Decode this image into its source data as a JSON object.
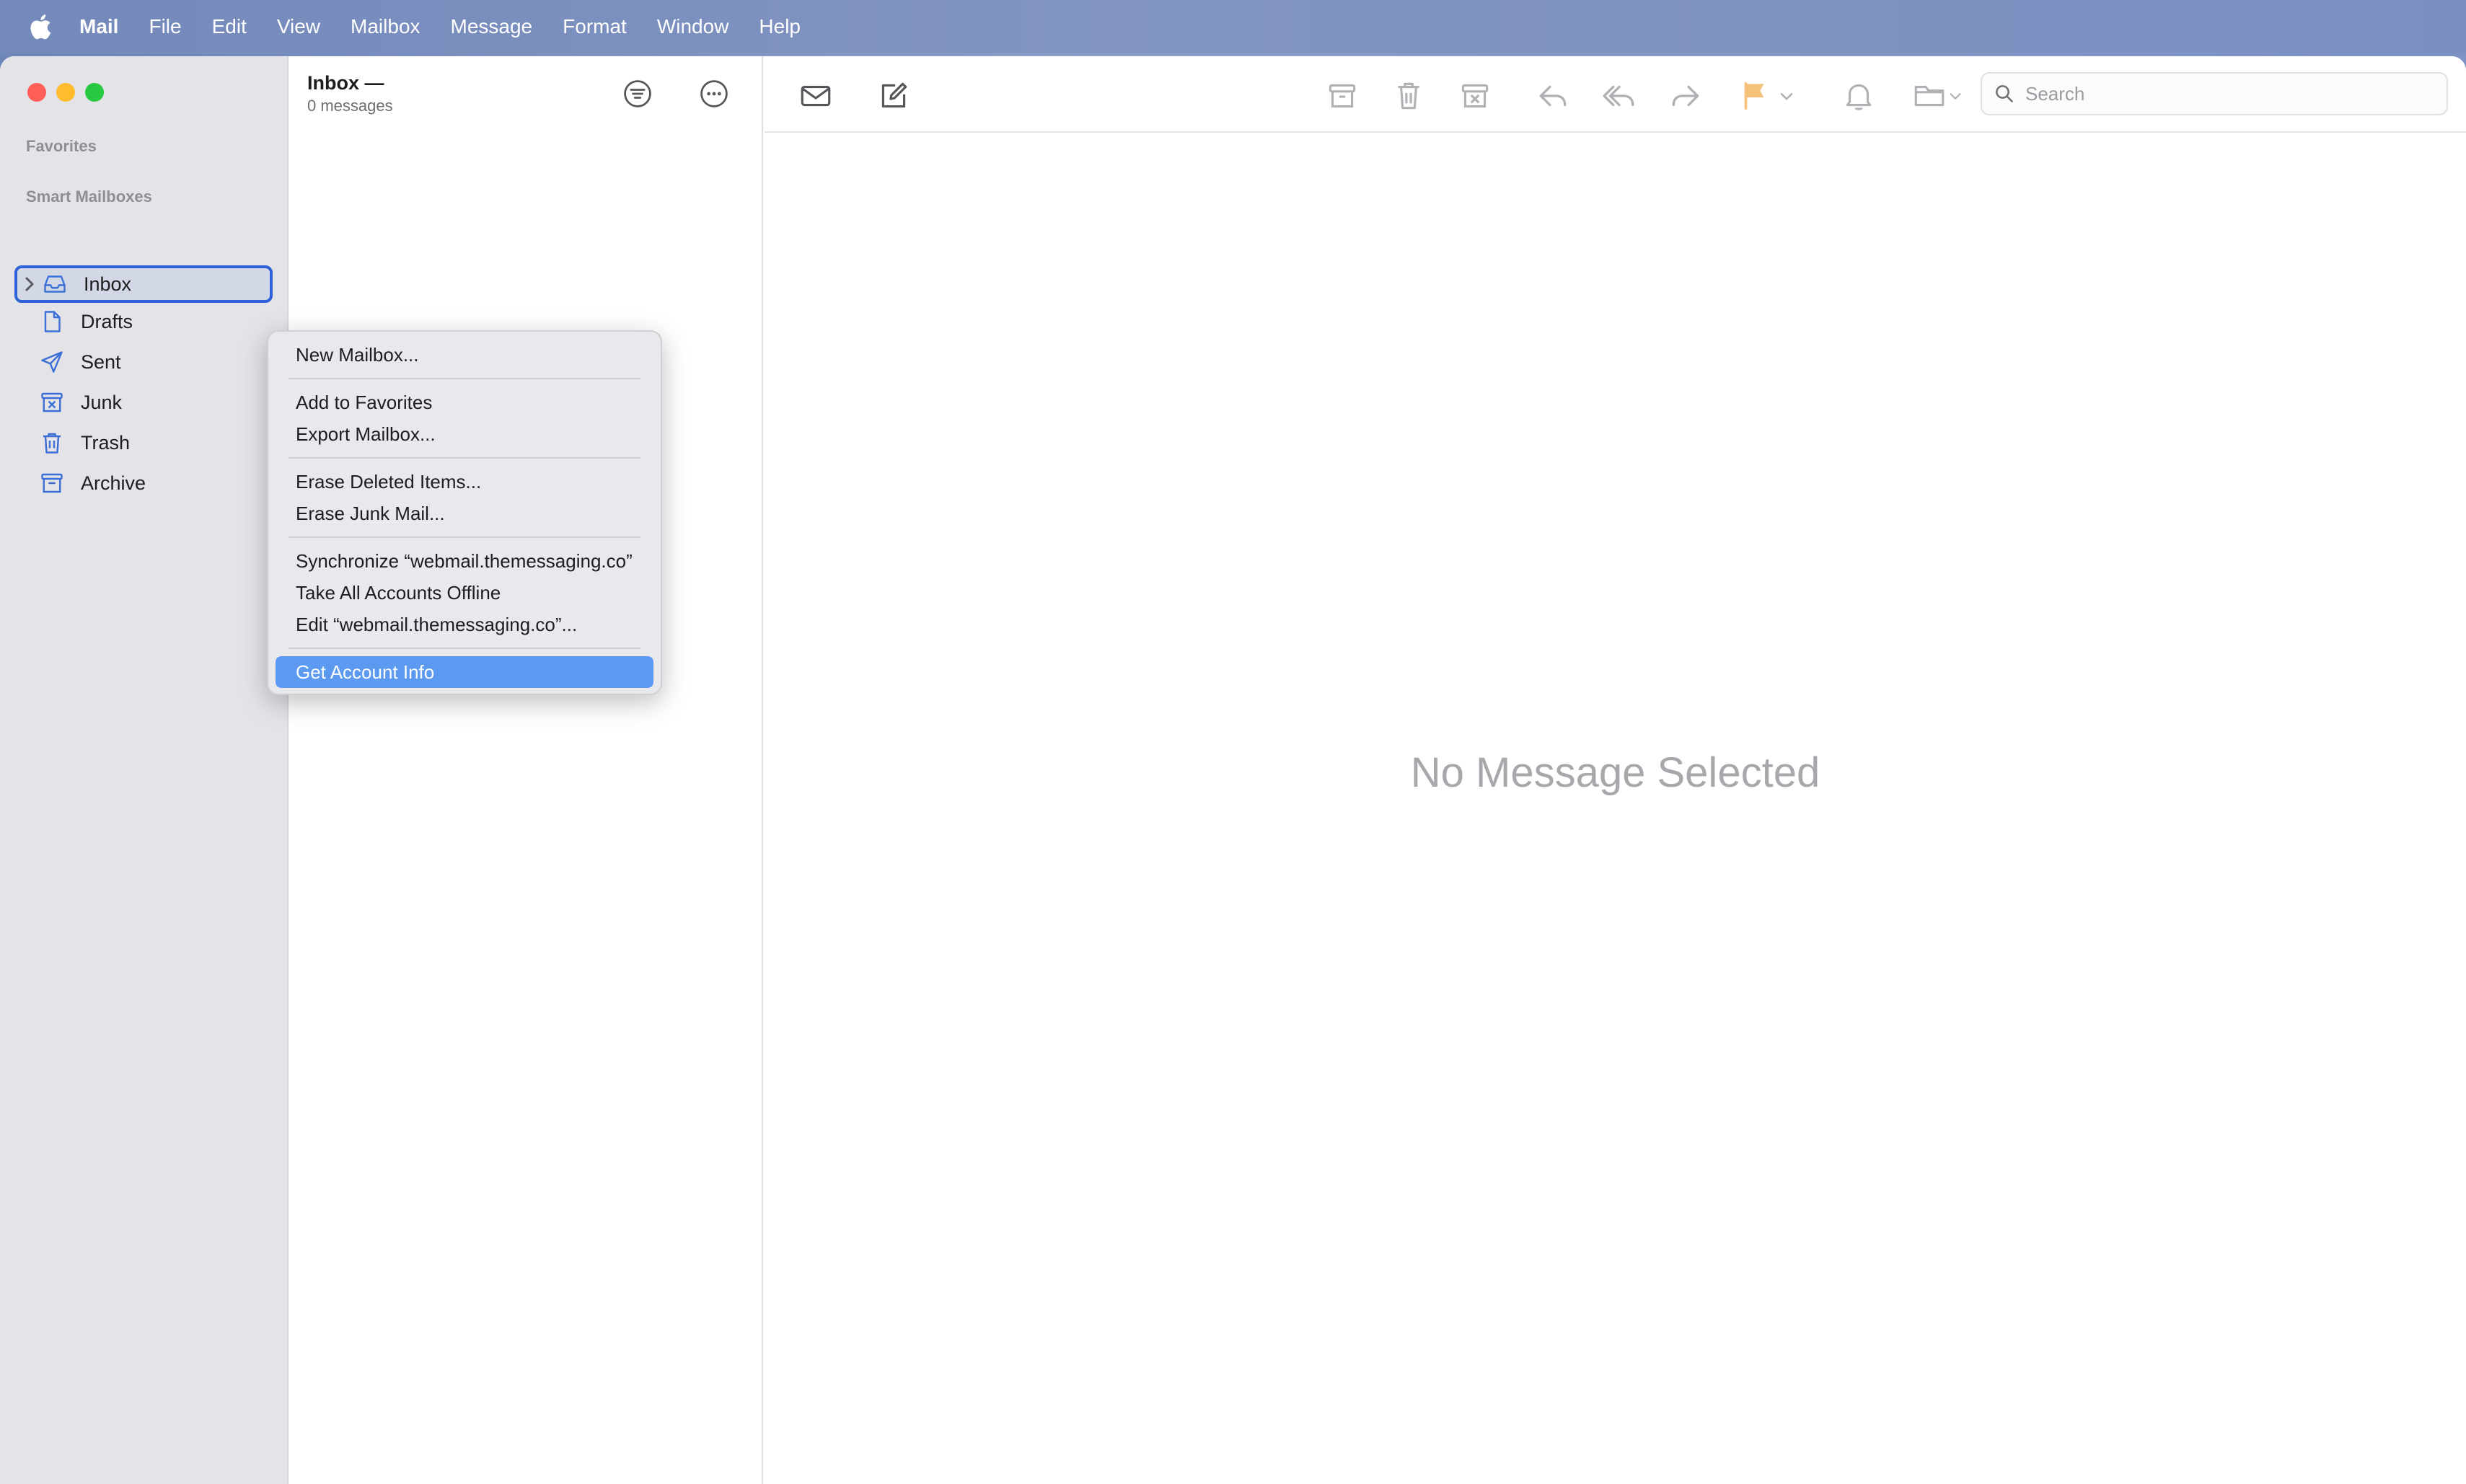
{
  "menubar": {
    "app_name": "Mail",
    "items": [
      "File",
      "Edit",
      "View",
      "Mailbox",
      "Message",
      "Format",
      "Window",
      "Help"
    ]
  },
  "sidebar": {
    "favorites_label": "Favorites",
    "smart_mailboxes_label": "Smart Mailboxes",
    "mailboxes": [
      {
        "label": "Inbox",
        "icon": "inbox-icon",
        "selected": true
      },
      {
        "label": "Drafts",
        "icon": "drafts-icon"
      },
      {
        "label": "Sent",
        "icon": "sent-icon"
      },
      {
        "label": "Junk",
        "icon": "junk-icon"
      },
      {
        "label": "Trash",
        "icon": "trash-icon"
      },
      {
        "label": "Archive",
        "icon": "archive-icon"
      }
    ]
  },
  "message_list": {
    "title": "Inbox —",
    "count": "0 messages"
  },
  "viewer": {
    "empty_state": "No Message Selected",
    "search_placeholder": "Search"
  },
  "context_menu": {
    "groups": [
      [
        "New Mailbox..."
      ],
      [
        "Add to Favorites",
        "Export Mailbox..."
      ],
      [
        "Erase Deleted Items...",
        "Erase Junk Mail..."
      ],
      [
        "Synchronize “webmail.themessaging.co”",
        "Take All Accounts Offline",
        "Edit “webmail.themessaging.co”..."
      ],
      [
        "Get Account Info"
      ]
    ],
    "highlighted": "Get Account Info"
  },
  "colors": {
    "accent": "#2f62d9",
    "icon_blue": "#3b6fd8",
    "menu_highlight": "#5b9af0",
    "flag": "#f4c27a"
  }
}
